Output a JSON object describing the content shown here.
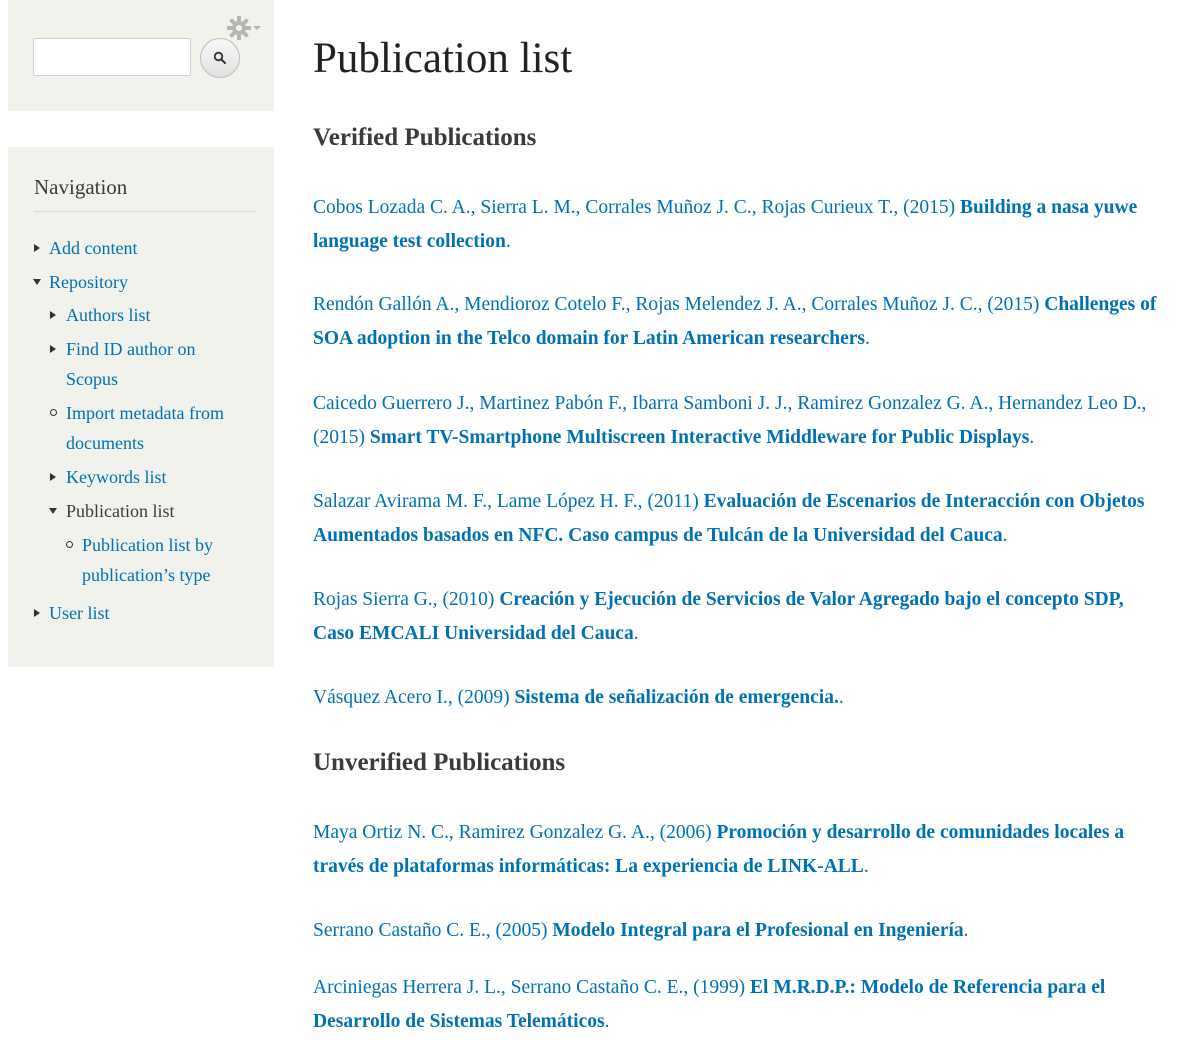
{
  "search": {
    "placeholder": ""
  },
  "navigation": {
    "title": "Navigation",
    "items": [
      {
        "label": "Add content"
      },
      {
        "label": "Repository"
      },
      {
        "label": "Authors list"
      },
      {
        "label": "Find ID author on Scopus"
      },
      {
        "label": "Import metadata from documents"
      },
      {
        "label": "Keywords list"
      },
      {
        "label": "Publication list"
      },
      {
        "label": "Publication list by publication’s type"
      },
      {
        "label": "User list"
      }
    ]
  },
  "main": {
    "title": "Publication list",
    "verified_title": "Verified Publications",
    "unverified_title": "Unverified Publications",
    "verified": [
      {
        "authors": "Cobos Lozada C. A., Sierra L. M., Corrales Muñoz J. C., Rojas Curieux T., ",
        "year": "(2015)",
        "title": "Building a nasa yuwe language test collection"
      },
      {
        "authors": "Rendón Gallón A., Mendioroz Cotelo F., Rojas Melendez J. A., Corrales Muñoz J. C., ",
        "year": "(2015)",
        "title": "Challenges of SOA adoption in the Telco domain for Latin American researchers"
      },
      {
        "authors": "Caicedo Guerrero J., Martinez Pabón F., Ibarra Samboni J. J., Ramirez Gonzalez G. A., Hernandez Leo D., ",
        "year": "(2015)",
        "title": "Smart TV-Smartphone Multiscreen Interactive Middleware for Public Displays"
      },
      {
        "authors": "Salazar Avirama M. F., Lame López H. F., ",
        "year": "(2011)",
        "title": "Evaluación de Escenarios de Interacción con Objetos Aumentados basados en NFC. Caso campus de Tulcán de la Universidad del Cauca"
      },
      {
        "authors": "Rojas Sierra G., ",
        "year": "(2010)",
        "title": "Creación y Ejecución de Servicios de Valor Agregado bajo el concepto SDP, Caso EMCALI Universidad del Cauca"
      },
      {
        "authors": "Vásquez Acero I., ",
        "year": "(2009)",
        "title": "Sistema de señalización de emergencia."
      }
    ],
    "unverified": [
      {
        "authors": "Maya Ortiz N. C., Ramirez Gonzalez G. A., ",
        "year": "(2006)",
        "title": "Promoción y desarrollo de comunidades locales a través de plataformas informáticas: La experiencia de LINK-ALL"
      },
      {
        "authors": "Serrano Castaño C. E., ",
        "year": "(2005)",
        "title": "Modelo Integral para el Profesional en Ingeniería"
      },
      {
        "authors": "Arciniegas Herrera J. L., Serrano Castaño C. E., ",
        "year": "(1999)",
        "title": "El M.R.D.P.: Modelo de Referencia para el Desarrollo de Sistemas Telemáticos"
      }
    ]
  },
  "colors": {
    "link": "#0071b3",
    "sidebar_bg": "#f2f2ed",
    "text": "#3b3b3b"
  },
  "icons": {
    "search_button": "search-icon",
    "settings": "gear-icon"
  }
}
